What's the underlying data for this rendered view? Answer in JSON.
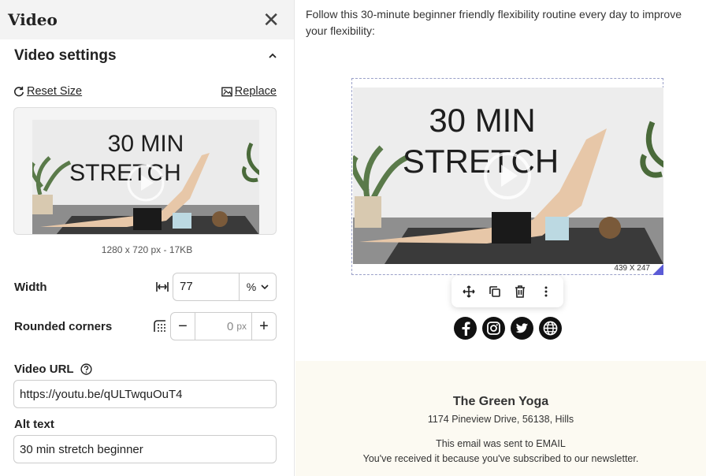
{
  "panel": {
    "title": "Video",
    "section_title": "Video settings",
    "reset_label": "Reset Size",
    "replace_label": "Replace",
    "image_meta": "1280 x 720 px - 17KB",
    "thumb_title_line1": "30 MIN",
    "thumb_title_line2": "STRETCH",
    "width_label": "Width",
    "width_value": "77",
    "width_unit": "%",
    "corners_label": "Rounded corners",
    "corners_value": "0",
    "corners_unit": "px",
    "video_url_label": "Video URL",
    "video_url_value": "https://youtu.be/qULTwquOuT4",
    "alt_text_label": "Alt text",
    "alt_text_value": "30 min stretch beginner"
  },
  "email": {
    "intro_text": "Follow this 30-minute beginner friendly flexibility routine every day to improve your flexibility:",
    "video_title_line1": "30 MIN",
    "video_title_line2": "STRETCH",
    "dimensions": "439 X 247",
    "footer": {
      "company": "The Green Yoga",
      "address": "1174 Pineview Drive, 56138, Hills",
      "sent_to": "This email was sent to EMAIL",
      "reason": "You've received it because you've subscribed to our newsletter."
    }
  },
  "colors": {
    "accent": "#5b5bd6",
    "footer_bg": "#fcfaf2",
    "header_bg": "#f3f3f3"
  },
  "icons": [
    "close-icon",
    "chevron-up-icon",
    "refresh-icon",
    "image-icon",
    "width-icon",
    "corners-icon",
    "help-icon",
    "move-icon",
    "duplicate-icon",
    "trash-icon",
    "more-icon",
    "facebook-icon",
    "instagram-icon",
    "twitter-icon",
    "globe-icon",
    "play-icon"
  ]
}
